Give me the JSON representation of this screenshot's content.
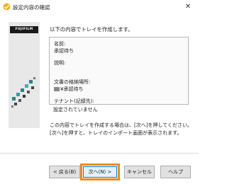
{
  "window": {
    "title": "設定内容の確認",
    "close_glyph": "✕"
  },
  "brand": {
    "logo_text": "FUJIFILM"
  },
  "main": {
    "heading": "以下の内容でトレイを作成します。",
    "summary": {
      "name_label": "名前:",
      "name_value": "承認待ち",
      "description_label": "説明:",
      "storage_label": "文書の格納場所:",
      "storage_value": "¥承認待ち",
      "tenant_label": "テナント(記録先):",
      "tenant_value": "設定されていません"
    },
    "note_line1": "この内容でトレイを作成する場合は、[次へ]を押してください。",
    "note_line2": "[次へ]を押すと、トレイのインポート画面が表示されます。"
  },
  "buttons": {
    "back": "< 戻る(B)",
    "next": "次へ(N) >",
    "cancel": "キャンセル",
    "help": "ヘルプ"
  },
  "colors": {
    "accent_highlight": "#f08a1c",
    "primary_button_border": "#0078d7",
    "graphic_teal": "#1e8a8a"
  }
}
